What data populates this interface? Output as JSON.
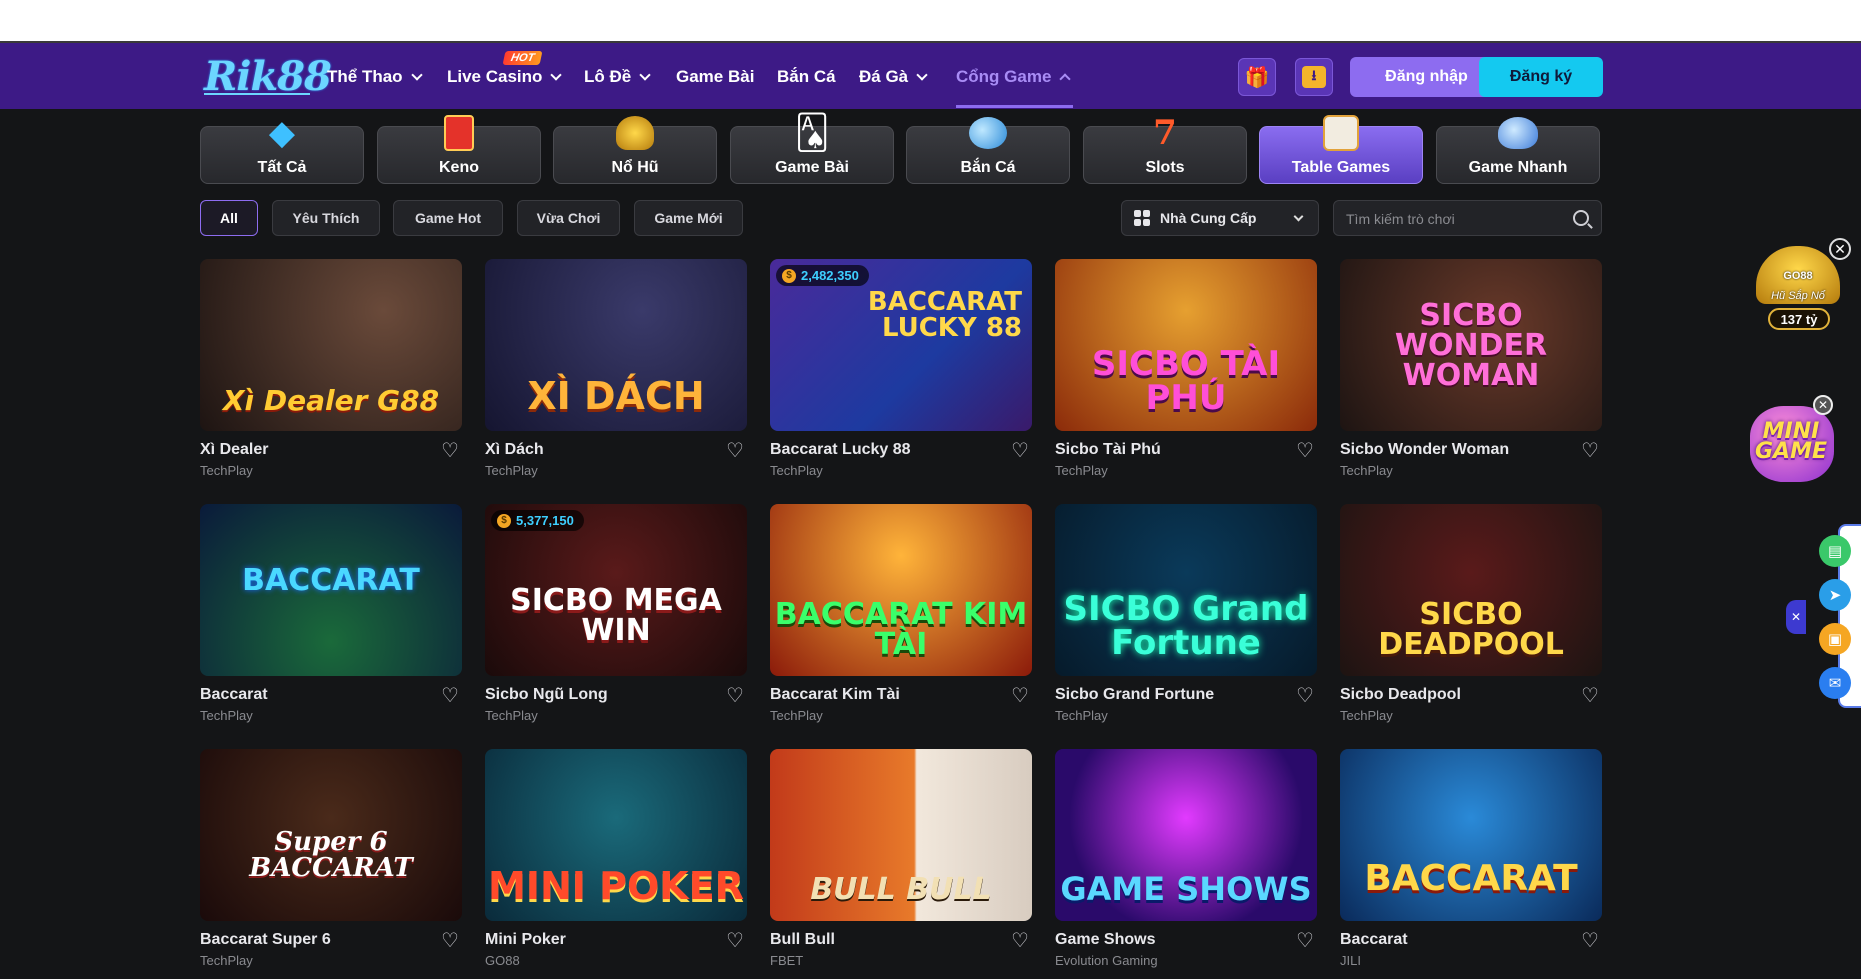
{
  "nav": {
    "logo": "Rik88",
    "items": [
      {
        "label": "Thể Thao",
        "dropdown": true
      },
      {
        "label": "Live Casino",
        "dropdown": true,
        "badge": "HOT"
      },
      {
        "label": "Lô Đề",
        "dropdown": true
      },
      {
        "label": "Game Bài",
        "dropdown": false
      },
      {
        "label": "Bắn Cá",
        "dropdown": false
      },
      {
        "label": "Đá Gà",
        "dropdown": true
      },
      {
        "label": "Cổng Game",
        "dropdown": true,
        "active": true
      }
    ],
    "login": "Đăng nhập",
    "register": "Đăng ký",
    "gift_icon": "gift-icon",
    "download_icon": "download-icon"
  },
  "categories": [
    {
      "label": "Tất Cả",
      "icon": "diamond-icon"
    },
    {
      "label": "Keno",
      "icon": "keno-icon"
    },
    {
      "label": "Nổ Hũ",
      "icon": "jar-icon"
    },
    {
      "label": "Game Bài",
      "icon": "cards-icon"
    },
    {
      "label": "Bắn Cá",
      "icon": "fish-icon"
    },
    {
      "label": "Slots",
      "icon": "seven-icon"
    },
    {
      "label": "Table Games",
      "icon": "table-icon",
      "active": true
    },
    {
      "label": "Game Nhanh",
      "icon": "rocket-icon"
    }
  ],
  "filters": {
    "chips": [
      "All",
      "Yêu Thích",
      "Game Hot",
      "Vừa Chơi",
      "Game Mới"
    ],
    "active_chip": "All",
    "provider_label": "Nhà Cung Cấp",
    "search_placeholder": "Tìm kiếm trò chơi"
  },
  "games": [
    {
      "title": "Xì Dealer",
      "provider": "TechPlay",
      "art": "Xì Dealer G88",
      "jackpot": null
    },
    {
      "title": "Xì Dách",
      "provider": "TechPlay",
      "art": "XÌ DÁCH",
      "jackpot": null
    },
    {
      "title": "Baccarat Lucky 88",
      "provider": "TechPlay",
      "art": "BACCARAT LUCKY 88",
      "jackpot": "2,482,350"
    },
    {
      "title": "Sicbo Tài Phú",
      "provider": "TechPlay",
      "art": "SICBO TÀI PHÚ",
      "jackpot": null
    },
    {
      "title": "Sicbo Wonder Woman",
      "provider": "TechPlay",
      "art": "SICBO WONDER WOMAN",
      "jackpot": null
    },
    {
      "title": "Baccarat",
      "provider": "TechPlay",
      "art": "BACCARAT",
      "jackpot": null
    },
    {
      "title": "Sicbo Ngũ Long",
      "provider": "TechPlay",
      "art": "SICBO MEGA WIN",
      "jackpot": "5,377,150"
    },
    {
      "title": "Baccarat Kim Tài",
      "provider": "TechPlay",
      "art": "BACCARAT KIM TÀI",
      "jackpot": null
    },
    {
      "title": "Sicbo Grand Fortune",
      "provider": "TechPlay",
      "art": "SICBO Grand Fortune",
      "jackpot": null
    },
    {
      "title": "Sicbo Deadpool",
      "provider": "TechPlay",
      "art": "SICBO DEADPOOL",
      "jackpot": null
    },
    {
      "title": "Baccarat Super 6",
      "provider": "TechPlay",
      "art": "Super 6 BACCARAT",
      "jackpot": null
    },
    {
      "title": "Mini Poker",
      "provider": "GO88",
      "art": "MINI POKER",
      "jackpot": null
    },
    {
      "title": "Bull Bull",
      "provider": "FBET",
      "art": "BULL BULL",
      "jackpot": null
    },
    {
      "title": "Game Shows",
      "provider": "Evolution Gaming",
      "art": "GAME SHOWS",
      "jackpot": null
    },
    {
      "title": "Baccarat",
      "provider": "JILI",
      "art": "BACCARAT",
      "jackpot": null
    }
  ],
  "side": {
    "jackpot_brand": "GO88",
    "jackpot_caption": "Hũ Sắp Nổ",
    "jackpot_amount": "137 tỷ",
    "mini_game": "MINI GAME"
  },
  "colors": {
    "nav_bg": "#3d1a86",
    "accent": "#8d6cf0",
    "register": "#14c9f0",
    "page_bg": "#141517"
  }
}
